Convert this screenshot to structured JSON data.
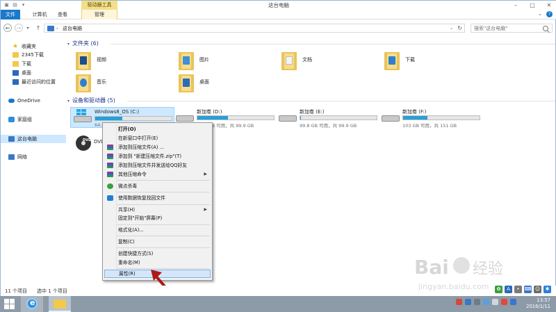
{
  "window": {
    "title": "这台电脑",
    "tool_tab_title": "驱动器工具",
    "controls": [
      "minimize",
      "maximize",
      "close"
    ]
  },
  "ribbon": {
    "tabs": [
      "文件",
      "计算机",
      "查看",
      "管理"
    ]
  },
  "address_bar": {
    "path": [
      "这台电脑"
    ],
    "search_placeholder": "搜索\"这台电脑\""
  },
  "nav_pane": {
    "items": [
      {
        "label": "收藏夹",
        "icon": "star-icon"
      },
      {
        "label": "2345下载",
        "icon": "folder-icon"
      },
      {
        "label": "下载",
        "icon": "downloads-folder-icon"
      },
      {
        "label": "桌面",
        "icon": "desktop-icon"
      },
      {
        "label": "最近访问的位置",
        "icon": "recent-places-icon"
      },
      {
        "label": "OneDrive",
        "icon": "onedrive-icon"
      },
      {
        "label": "家庭组",
        "icon": "homegroup-icon"
      },
      {
        "label": "这台电脑",
        "icon": "this-pc-icon"
      },
      {
        "label": "网络",
        "icon": "network-icon"
      }
    ]
  },
  "folders_group": {
    "header": "文件夹 (6)",
    "items": [
      "视频",
      "图片",
      "文档",
      "下载",
      "音乐",
      "桌面"
    ]
  },
  "drives_group": {
    "header": "设备和驱动器 (5)",
    "drives": [
      {
        "name": "Windows8_OS (C:)",
        "free": "64.8",
        "used_fraction": 0.35
      },
      {
        "name": "新加卷 (D:)",
        "free": "59.9 GB 可用，共 99.9 GB",
        "used_fraction": 0.4
      },
      {
        "name": "新加卷 (E:)",
        "free": "99.8 GB 可用，共 99.9 GB",
        "used_fraction": 0.01
      },
      {
        "name": "新加卷 (F:)",
        "free": "103 GB 可用，共 151 GB",
        "used_fraction": 0.32
      }
    ],
    "dvd_label": "DVD"
  },
  "context_menu": {
    "items": [
      {
        "label": "打开(O)",
        "bold": true
      },
      {
        "label": "在新窗口中打开(E)"
      },
      {
        "label": "添加到压缩文件(A) ...",
        "icon": "winrar-icon"
      },
      {
        "label": "添加到 \"新建压缩文件.zip\"(T)",
        "icon": "winrar-icon"
      },
      {
        "label": "添加到压缩文件并发送给QQ好友",
        "icon": "winrar-icon"
      },
      {
        "label": "其他压缩命令",
        "icon": "winrar-icon",
        "submenu": true
      },
      {
        "label": "微点杀毒",
        "icon": "antivirus-icon"
      },
      {
        "label": "使用数据恢复找回文件",
        "icon": "data-recovery-icon"
      },
      {
        "label": "共享(H)",
        "submenu": true
      },
      {
        "label": "固定到\"开始\"屏幕(P)"
      },
      {
        "label": "格式化(A)..."
      },
      {
        "label": "复制(C)"
      },
      {
        "label": "创建快捷方式(S)"
      },
      {
        "label": "重命名(M)"
      },
      {
        "label": "属性(R)",
        "highlighted": true
      }
    ]
  },
  "status_bar": {
    "item_count": "11 个项目",
    "selected": "选中 1 个项目"
  },
  "taskbar": {
    "time": "13:57",
    "date": "2016/1/11"
  },
  "watermark": {
    "text": "Baidu经验",
    "url": "jingyan.baidu.com"
  },
  "colors": {
    "accent": "#1979ca",
    "selection": "#cde8ff",
    "tool_tab": "#f3df8a",
    "drive_bar": "#26a0da",
    "arrow": "#b01818"
  }
}
